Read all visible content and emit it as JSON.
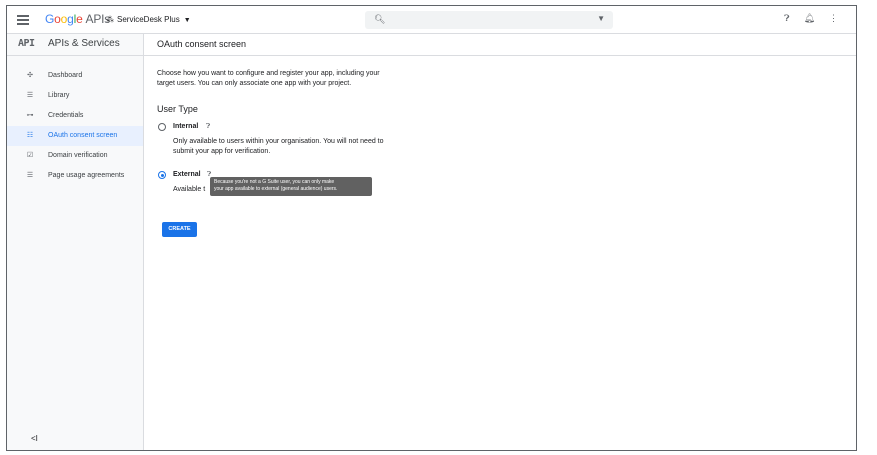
{
  "topbar": {
    "logo_google": "Google",
    "logo_apis": "APIs",
    "project_icon": "⁂",
    "project_name": "ServiceDesk Plus",
    "project_caret": "▼",
    "search_icon": "search-icon",
    "icons": [
      "help-icon",
      "notifications-icon",
      "more-vert-icon"
    ]
  },
  "sidebar": {
    "badge": "API",
    "title": "APIs & Services",
    "items": [
      {
        "icon": "✣",
        "label": "Dashboard",
        "active": false
      },
      {
        "icon": "☰",
        "label": "Library",
        "active": false
      },
      {
        "icon": "⊶",
        "label": "Credentials",
        "active": false
      },
      {
        "icon": "☷",
        "label": "OAuth consent screen",
        "active": true
      },
      {
        "icon": "☑",
        "label": "Domain verification",
        "active": false
      },
      {
        "icon": "☰",
        "label": "Page usage agreements",
        "active": false
      }
    ],
    "collapse": "<I"
  },
  "main": {
    "page_title": "OAuth consent screen",
    "intro_line1": "Choose how you want to configure and register your app, including your",
    "intro_line2": "target users. You can only associate one app with your project.",
    "section_title": "User Type",
    "internal_label": "Internal",
    "internal_desc_line1": "Only available to users within your organisation. You will not need to",
    "internal_desc_line2": "submit your app for verification.",
    "external_label": "External",
    "external_desc": "Available t",
    "tooltip_line1": "Because you're not a G Suite user, you can only make",
    "tooltip_line2": "your app available to external (general audience) users.",
    "create_label": "CREATE"
  },
  "colors": {
    "accent": "#1a73e8",
    "active_bg": "#e8f0fe",
    "tooltip_bg": "#616161"
  }
}
